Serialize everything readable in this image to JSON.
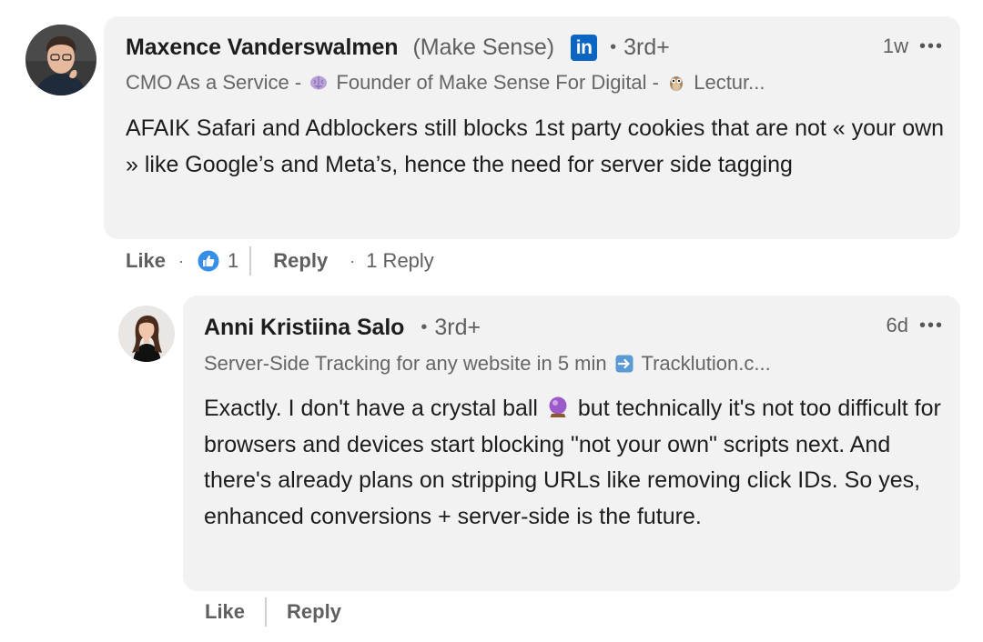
{
  "comments": [
    {
      "author": "Maxence Vanderswalmen",
      "org": "(Make Sense)",
      "linkedin_badge": "in",
      "degree": "3rd+",
      "time": "1w",
      "headline_parts": [
        "CMO As a Service - ",
        " Founder of Make Sense For Digital - ",
        " Lectur..."
      ],
      "headline_icons": [
        "brain-emoji-icon",
        "owl-emoji-icon"
      ],
      "body": "AFAIK Safari and Adblockers still blocks 1st party cookies that are not « your own » like Google’s and Meta’s, hence the need for server side tagging",
      "actions": {
        "like": "Like",
        "reaction_count": "1",
        "reply": "Reply",
        "replies": "1 Reply"
      }
    },
    {
      "author": "Anni Kristiina Salo",
      "degree": "3rd+",
      "time": "6d",
      "headline_parts": [
        "Server-Side Tracking for any website in 5 min ",
        " Tracklution.c..."
      ],
      "headline_icons": [
        "right-arrow-emoji-icon"
      ],
      "body_parts": [
        "Exactly. I don't have a crystal ball ",
        " but technically it's not too difficult for browsers and devices start blocking \"not your own\" scripts next. And there's already plans on stripping URLs like removing click IDs. So yes, enhanced conversions + server-side is the future."
      ],
      "body_icons": [
        "crystal-ball-emoji-icon"
      ],
      "actions": {
        "like": "Like",
        "reply": "Reply"
      }
    }
  ],
  "ui": {
    "more_glyph": "•••",
    "separator_dot": "·",
    "degree_dot": "•"
  },
  "colors": {
    "bubble_bg": "#f2f2f2",
    "linkedin_blue": "#0a66c2",
    "secondary_text": "#5f5f5f",
    "primary_text": "#1d1d1d"
  }
}
